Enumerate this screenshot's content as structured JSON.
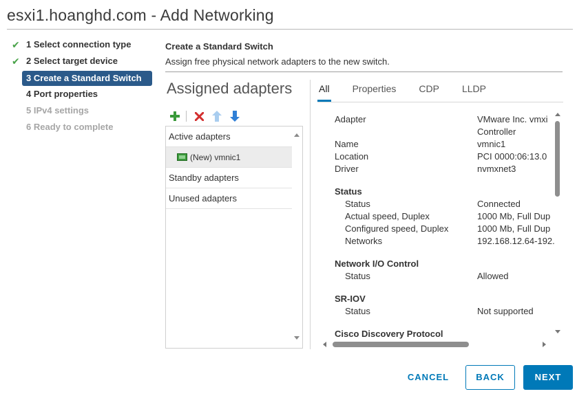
{
  "window": {
    "title": "esxi1.hoanghd.com - Add Networking"
  },
  "steps": [
    {
      "label": "1 Select connection type",
      "state": "done"
    },
    {
      "label": "2 Select target device",
      "state": "done"
    },
    {
      "label": "3 Create a Standard Switch",
      "state": "active"
    },
    {
      "label": "4 Port properties",
      "state": "pending"
    },
    {
      "label": "5 IPv4 settings",
      "state": "disabled"
    },
    {
      "label": "6 Ready to complete",
      "state": "disabled"
    }
  ],
  "section": {
    "title": "Create a Standard Switch",
    "description": "Assign free physical network adapters to the new switch."
  },
  "adapters": {
    "heading": "Assigned adapters",
    "toolbar_icons": [
      "add-icon",
      "remove-icon",
      "move-up-icon",
      "move-down-icon"
    ],
    "groups": {
      "active": "Active adapters",
      "standby": "Standby adapters",
      "unused": "Unused adapters"
    },
    "active_items": [
      "(New) vmnic1"
    ]
  },
  "tabs": [
    "All",
    "Properties",
    "CDP",
    "LLDP"
  ],
  "active_tab": "All",
  "details": {
    "adapter_label": "Adapter",
    "adapter_value_1": "VMware Inc. vmxi",
    "adapter_value_2": "Controller",
    "name_label": "Name",
    "name_value": "vmnic1",
    "location_label": "Location",
    "location_value": "PCI 0000:06:13.0",
    "driver_label": "Driver",
    "driver_value": "nvmxnet3",
    "status_heading": "Status",
    "status_label": "Status",
    "status_value": "Connected",
    "actual_speed_label": "Actual speed, Duplex",
    "actual_speed_value": "1000 Mb, Full Dup",
    "configured_speed_label": "Configured speed, Duplex",
    "configured_speed_value": "1000 Mb, Full Dup",
    "networks_label": "Networks",
    "networks_value": "192.168.12.64-192.",
    "nioc_heading": "Network I/O Control",
    "nioc_status_label": "Status",
    "nioc_status_value": "Allowed",
    "sriov_heading": "SR-IOV",
    "sriov_status_label": "Status",
    "sriov_status_value": "Not supported",
    "cdp_heading": "Cisco Discovery Protocol"
  },
  "buttons": {
    "cancel": "CANCEL",
    "back": "BACK",
    "next": "NEXT"
  },
  "colors": {
    "accent": "#0079b8",
    "active_step": "#2b5a8a",
    "check": "#4aa34a",
    "remove": "#d32f2f"
  }
}
